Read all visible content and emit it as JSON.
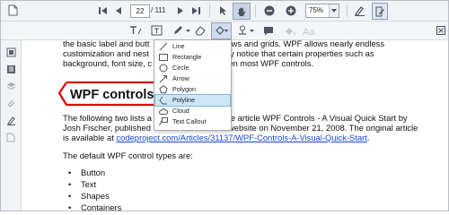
{
  "toolbar": {
    "page_current": "22",
    "page_total": "/ 111",
    "zoom": "75%"
  },
  "document": {
    "line1": "the basic label and butt",
    "line1b": "ews and grids. WPF allows nearly endless",
    "line2": "customization and nest",
    "line2b": "ily notice that certain properties such as",
    "line3": "background, font size, c",
    "line3b": "een most WPF controls.",
    "heading": "WPF controls",
    "para2_a1": "The following two lists a",
    "para2_a2": "the article WPF Controls - A Visual Quick Start by",
    "para2_b1": "Josh Fischer, published",
    "para2_b2": "website on November 21, 2008. The original article",
    "para2_c1": "is available at ",
    "para2_link": "codeproject.com/Articles/31137/WPF-Controls-A-Visual-Quick-Start",
    "para2_c2": ".",
    "para3": "The default WPF control types are:",
    "bullets": [
      "Button",
      "Text",
      "Shapes",
      "Containers"
    ]
  },
  "shapes_menu": {
    "items": [
      {
        "label": "Line",
        "icon": "line-icon"
      },
      {
        "label": "Rectangle",
        "icon": "rectangle-icon"
      },
      {
        "label": "Circle",
        "icon": "circle-icon"
      },
      {
        "label": "Arrow",
        "icon": "arrow-icon"
      },
      {
        "label": "Polygon",
        "icon": "polygon-icon"
      },
      {
        "label": "Polyline",
        "icon": "polyline-icon",
        "selected": true
      },
      {
        "label": "Cloud",
        "icon": "cloud-icon"
      },
      {
        "label": "Text Callout",
        "icon": "text-callout-icon"
      }
    ]
  },
  "colors": {
    "accent_selected": "#cfe6f7",
    "heading_callout": "#e00000",
    "link": "#1a47d6"
  }
}
